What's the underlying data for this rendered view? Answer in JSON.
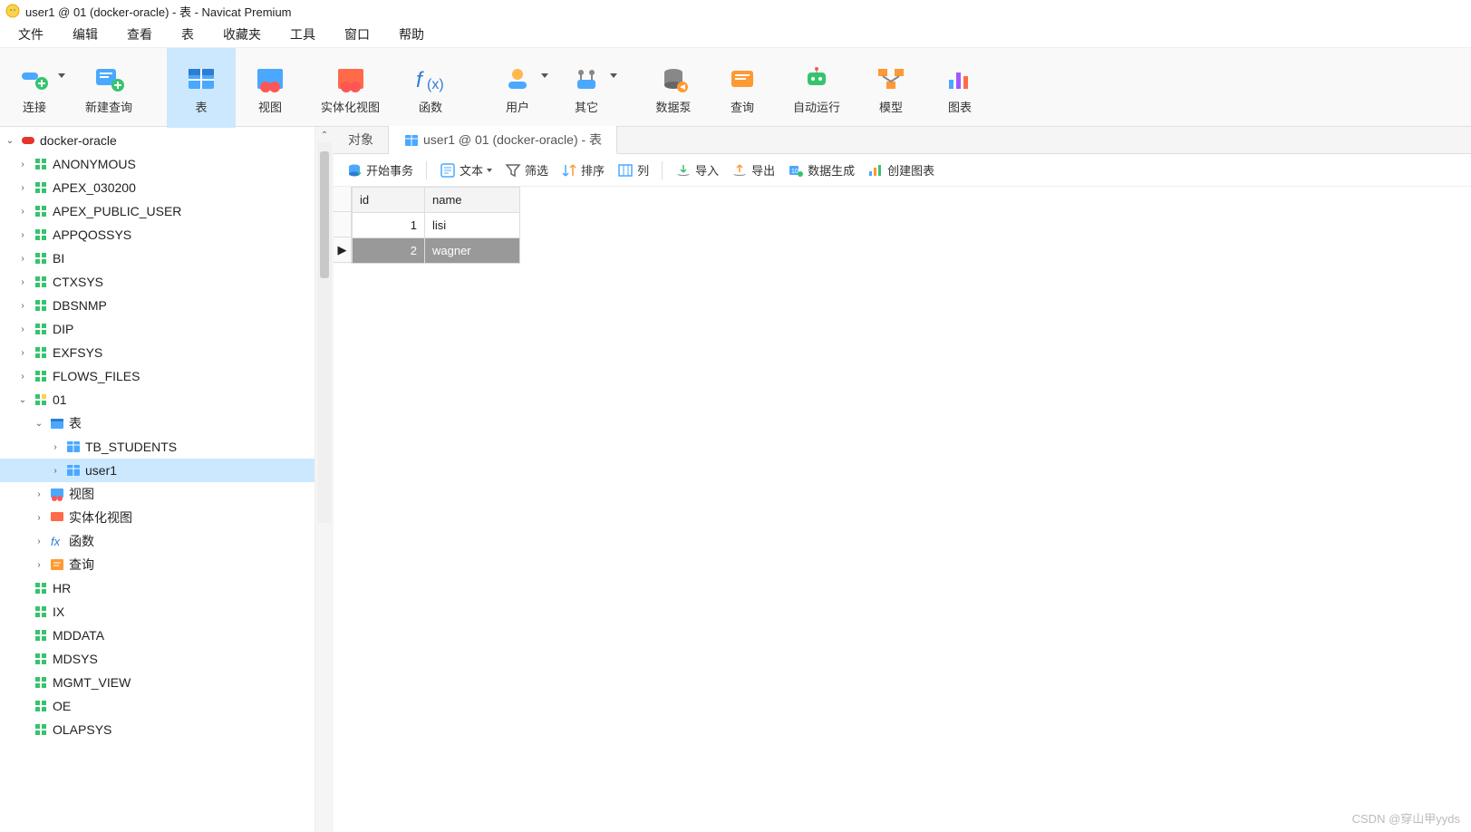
{
  "title": "user1 @ 01 (docker-oracle) - 表 - Navicat Premium",
  "menubar": [
    "文件",
    "编辑",
    "查看",
    "表",
    "收藏夹",
    "工具",
    "窗口",
    "帮助"
  ],
  "toolbar": [
    {
      "label": "连接",
      "name": "connection-button",
      "dropdown": true,
      "icon": "plug"
    },
    {
      "label": "新建查询",
      "name": "new-query-button",
      "icon": "query-new"
    },
    {
      "gap": true
    },
    {
      "label": "表",
      "name": "table-button",
      "active": true,
      "icon": "table"
    },
    {
      "label": "视图",
      "name": "view-button",
      "icon": "view"
    },
    {
      "label": "实体化视图",
      "name": "materialized-view-button",
      "icon": "mview"
    },
    {
      "label": "函数",
      "name": "function-button",
      "icon": "fx"
    },
    {
      "gap": true
    },
    {
      "label": "用户",
      "name": "user-button",
      "icon": "user",
      "dropdown": true
    },
    {
      "label": "其它",
      "name": "other-button",
      "icon": "other",
      "dropdown": true
    },
    {
      "gap": true
    },
    {
      "label": "数据泵",
      "name": "datapump-button",
      "icon": "db"
    },
    {
      "label": "查询",
      "name": "query-button",
      "icon": "query"
    },
    {
      "label": "自动运行",
      "name": "autorun-button",
      "icon": "robot"
    },
    {
      "label": "模型",
      "name": "model-button",
      "icon": "model"
    },
    {
      "label": "图表",
      "name": "chart-button",
      "icon": "chart"
    }
  ],
  "tree": {
    "root": {
      "label": "docker-oracle",
      "expanded": true
    },
    "schemas_top": [
      "ANONYMOUS",
      "APEX_030200",
      "APEX_PUBLIC_USER",
      "APPQOSSYS",
      "BI",
      "CTXSYS",
      "DBSNMP",
      "DIP",
      "EXFSYS",
      "FLOWS_FILES"
    ],
    "current_schema": "01",
    "table_group": {
      "label": "表",
      "expanded": true,
      "items": [
        "TB_STUDENTS",
        "user1"
      ],
      "selected": "user1"
    },
    "other_groups": [
      "视图",
      "实体化视图",
      "函数",
      "查询"
    ],
    "schemas_bottom": [
      "HR",
      "IX",
      "MDDATA",
      "MDSYS",
      "MGMT_VIEW",
      "OE",
      "OLAPSYS"
    ]
  },
  "tabs": [
    {
      "label": "对象",
      "name": "tab-objects",
      "active": false
    },
    {
      "label": "user1 @ 01 (docker-oracle) - 表",
      "name": "tab-user1-table",
      "active": true,
      "icon": "table"
    }
  ],
  "actions": [
    {
      "label": "开始事务",
      "name": "begin-transaction",
      "icon": "tx"
    },
    {
      "sep": true
    },
    {
      "label": "文本",
      "name": "text-mode",
      "icon": "text",
      "dropdown": true
    },
    {
      "label": "筛选",
      "name": "filter",
      "icon": "filter"
    },
    {
      "label": "排序",
      "name": "sort",
      "icon": "sort"
    },
    {
      "label": "列",
      "name": "columns",
      "icon": "cols"
    },
    {
      "sep": true
    },
    {
      "label": "导入",
      "name": "import",
      "icon": "import"
    },
    {
      "label": "导出",
      "name": "export",
      "icon": "export"
    },
    {
      "label": "数据生成",
      "name": "data-gen",
      "icon": "datagen"
    },
    {
      "label": "创建图表",
      "name": "create-chart",
      "icon": "chartgen"
    }
  ],
  "grid": {
    "columns": [
      "id",
      "name"
    ],
    "rows": [
      {
        "id": "1",
        "name": "lisi",
        "selected": false
      },
      {
        "id": "2",
        "name": "wagner",
        "selected": true
      }
    ]
  },
  "watermark": "CSDN @穿山甲yyds"
}
